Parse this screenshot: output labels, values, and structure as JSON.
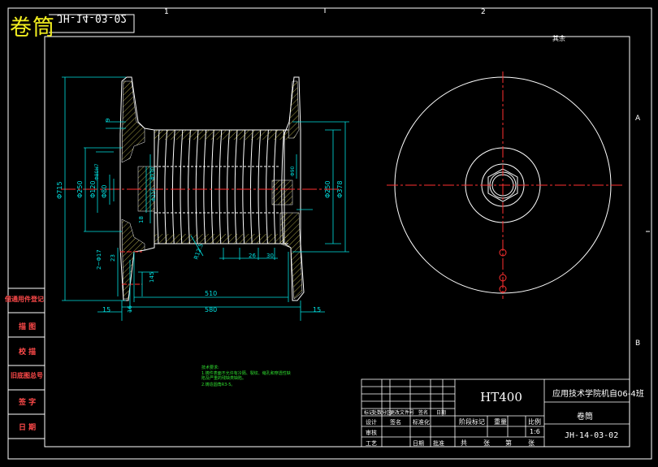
{
  "title": "卷筒",
  "drawing_code_mirrored": "JH-14-03-02",
  "material": "HT400",
  "company": "应用技术学院机自06-4班",
  "part_name": "卷筒",
  "drawing_no": "JH-14-03-02",
  "scale": "1:6",
  "surface_note": "其余",
  "zone_top": [
    "1",
    "2"
  ],
  "zone_right": [
    "A",
    "B"
  ],
  "side_labels": [
    "借通用件登记",
    "旧底图总号",
    "描 图",
    "校 描",
    "签 字",
    "日 期"
  ],
  "tech_notes": [
    "技术要求:",
    "1.铸件表面不允许有冷隔、裂纹、缩孔和穿透性缺陷及严重的残缺类缺陷。",
    "2.铸造圆角R3-5。"
  ],
  "title_block": {
    "r1": [
      "标记",
      "处数",
      "分区",
      "更改文件号",
      "签名",
      "日期"
    ],
    "r2": [
      "设计",
      "签名",
      "标准化"
    ],
    "r3": [
      "审核"
    ],
    "r4": [
      "工艺",
      "日期",
      "",
      "批准"
    ],
    "stage": [
      "阶段标记",
      "重量",
      "比例"
    ],
    "sheets": [
      "共",
      "张",
      "第",
      "张"
    ]
  },
  "dimensions": {
    "d715": "Φ715",
    "d250l": "Φ250",
    "d120": "Φ120",
    "d80": "Φ80",
    "dH7": "Φ80H7",
    "d210": "Φ210",
    "d250r": "Φ250",
    "d378": "Φ378",
    "d90": "Φ90",
    "d230": "Φ230",
    "r125": "R12.5",
    "r26": "26",
    "r30": "30",
    "r23": "23",
    "r145": "145",
    "r16": "16",
    "r2": "2~Φ17",
    "r9": "9",
    "r18": "18",
    "w510": "510",
    "w580": "580",
    "w15a": "15",
    "w15b": "15"
  }
}
